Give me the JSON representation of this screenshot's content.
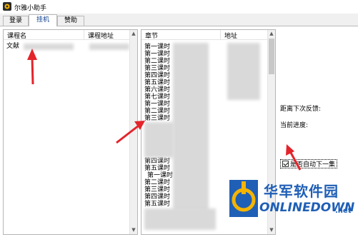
{
  "window": {
    "title": "尔雅小助手"
  },
  "tabs": [
    {
      "label": "登录",
      "active": false
    },
    {
      "label": "挂机",
      "active": true
    },
    {
      "label": "赞助",
      "active": false
    }
  ],
  "course_list": {
    "columns": [
      "课程名",
      "课程地址"
    ],
    "rows": [
      {
        "name": "文献"
      }
    ]
  },
  "chapter_list": {
    "columns": [
      "章节",
      "地址"
    ],
    "rows": [
      "第一课时",
      "第一课时",
      "第二课时",
      "第三课时",
      "第四课时",
      "第五课时",
      "第六课时",
      "第七课时",
      "第一课时",
      "第二课时",
      "第三课时",
      "",
      "",
      "",
      "",
      "",
      "第四课时",
      "第五课时",
      "第一课时",
      "第二课时",
      "第三课时",
      "第四课时",
      "第五课时"
    ]
  },
  "status": {
    "next_feedback_label": "距离下次反馈:",
    "progress_label": "当前进度:",
    "auto_next_label": "是否自动下一集",
    "auto_next_checked": true
  },
  "watermark": {
    "chinese": "华军软件园",
    "english": "ONLINEDOWN",
    "suffix": ".net"
  },
  "colors": {
    "accent_blue": "#1f5fb6",
    "watermark_yellow": "#f5b400",
    "arrow_red": "#e3242b"
  }
}
